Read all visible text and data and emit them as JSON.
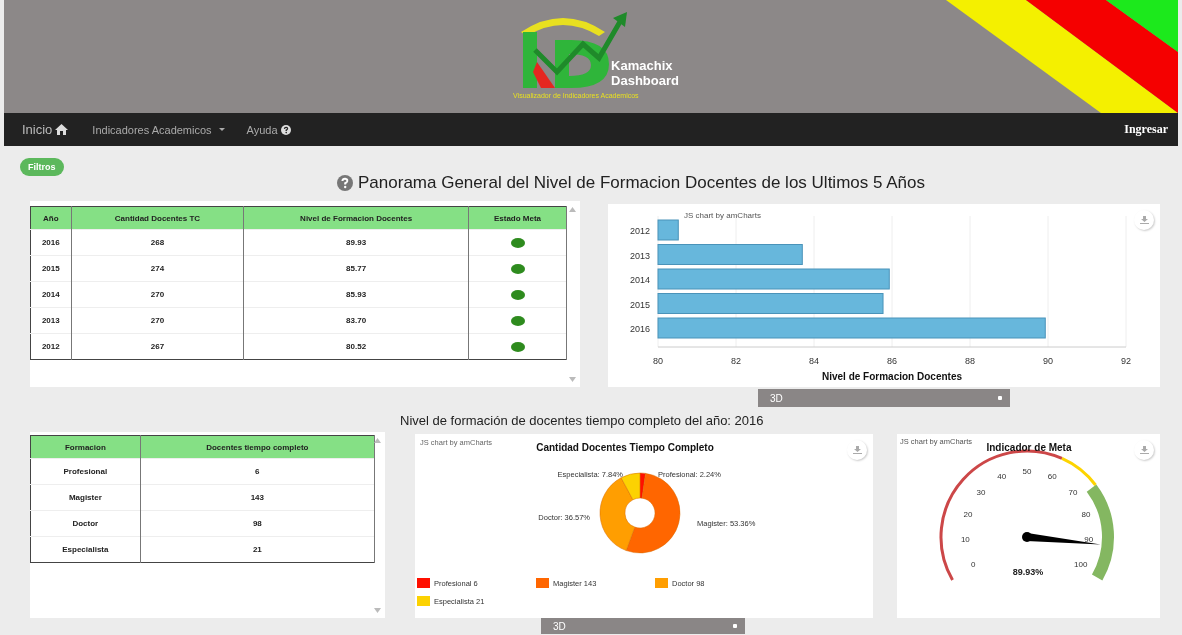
{
  "header": {
    "brand": "Kamachix",
    "brand_line2": "Dashboard",
    "tagline": "Visualizador de Indicadores Academicos"
  },
  "nav": {
    "items": [
      {
        "label": "Inicio",
        "kind": "home"
      },
      {
        "label": "Indicadores Academicos",
        "kind": "dropdown"
      },
      {
        "label": "Ayuda",
        "kind": "help"
      }
    ],
    "login": "Ingresar"
  },
  "filter_button": "Filtros",
  "title": "Panorama General del Nivel de Formacion Docentes de los Ultimos 5 Años",
  "goal_table": {
    "columns": [
      "Año",
      "Cantidad Docentes TC",
      "Nivel de Formacion Docentes",
      "Estado Meta"
    ],
    "rows": [
      {
        "year": "2016",
        "count": "268",
        "level": "89.93",
        "color": "#2e8b1e"
      },
      {
        "year": "2015",
        "count": "274",
        "level": "85.77",
        "color": "#2e8b1e"
      },
      {
        "year": "2014",
        "count": "270",
        "level": "85.93",
        "color": "#2e8b1e"
      },
      {
        "year": "2013",
        "count": "270",
        "level": "83.70",
        "color": "#2e8b1e"
      },
      {
        "year": "2012",
        "count": "267",
        "level": "80.52",
        "color": "#2e8b1e"
      }
    ]
  },
  "bar_panel": {
    "credit": "JS chart by amCharts",
    "mode": "3D",
    "chart_data": {
      "type": "bar",
      "orientation": "horizontal",
      "xlabel": "Nivel de Formacion Docentes",
      "categories": [
        "2012",
        "2013",
        "2014",
        "2015",
        "2016"
      ],
      "series": [
        {
          "color": "#67b7dc",
          "values": [
            80.52,
            83.7,
            85.93,
            85.77,
            89.93
          ]
        }
      ],
      "xlim": [
        80,
        92
      ],
      "xticks": [
        80,
        82,
        84,
        86,
        88,
        90,
        92
      ],
      "grid": true
    }
  },
  "subtitle": "Nivel de formación de docentes tiempo completo del año: 2016",
  "formation_table": {
    "columns": [
      "Formacion",
      "Docentes tiempo completo"
    ],
    "rows": [
      {
        "name": "Profesional",
        "count": "6"
      },
      {
        "name": "Magister",
        "count": "143"
      },
      {
        "name": "Doctor",
        "count": "98"
      },
      {
        "name": "Especialista",
        "count": "21"
      }
    ]
  },
  "donut_panel": {
    "credit": "JS chart by amCharts",
    "mode": "3D",
    "slice_labels": [
      "Profesional: 2.24%",
      "Magister: 53.36%",
      "Doctor: 36.57%",
      "Especialista: 7.84%"
    ],
    "legend_values": [
      "6",
      "143",
      "98",
      "21"
    ],
    "chart_data": {
      "type": "donut",
      "title": "Cantidad Docentes Tiempo Completo",
      "categories": [
        "Profesional",
        "Magister",
        "Doctor",
        "Especialista"
      ],
      "values": [
        2.24,
        53.36,
        36.57,
        7.84
      ],
      "colors": [
        "#ff0f00",
        "#ff6600",
        "#ff9e01",
        "#fcd202"
      ]
    }
  },
  "gauge_panel": {
    "credit": "JS chart by amCharts",
    "title": "Indicador de Meta",
    "ticks": [
      "0",
      "10",
      "20",
      "30",
      "40",
      "50",
      "60",
      "70",
      "80",
      "90",
      "100"
    ],
    "reading": "89.93%",
    "level": 0.8993
  }
}
